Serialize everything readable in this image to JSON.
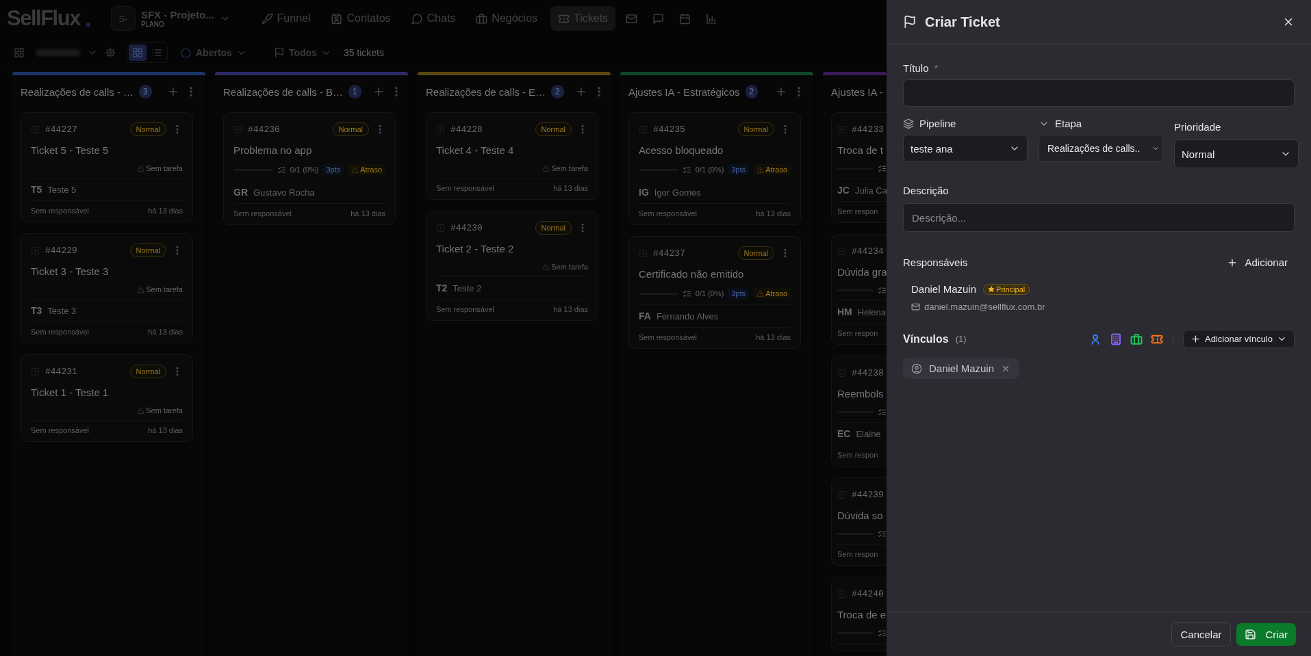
{
  "app": {
    "logo": "SellFlux",
    "workspace": {
      "avatar": "S-",
      "name": "SFX - Projeto...",
      "plan": "PLANO"
    }
  },
  "nav": [
    {
      "label": "Funnel",
      "selected": false
    },
    {
      "label": "Contatos",
      "selected": false
    },
    {
      "label": "Chats",
      "selected": false
    },
    {
      "label": "Negócios",
      "selected": false
    },
    {
      "label": "Tickets",
      "selected": true
    }
  ],
  "toolbar": {
    "views": [
      {
        "selected": true
      },
      {
        "selected": false
      }
    ],
    "status_filter": "Abertos",
    "type_filter": "Todos",
    "count": "35 tickets"
  },
  "columns": [
    {
      "title": "Realizações de calls - …",
      "count": "3",
      "color": "#1b3566",
      "cards": [
        {
          "kind": "no_task",
          "id": "#44227",
          "priority": "Normal",
          "title": "Ticket 5 - Teste 5",
          "task": "Sem tarefa",
          "initials": "T5",
          "contact": "Teste 5",
          "assignee": "Sem responsável",
          "age": "há 13 dias"
        },
        {
          "kind": "no_task",
          "id": "#44229",
          "priority": "Normal",
          "title": "Ticket 3 - Teste 3",
          "task": "Sem tarefa",
          "initials": "T3",
          "contact": "Teste 3",
          "assignee": "Sem responsável",
          "age": "há 13 dias"
        },
        {
          "kind": "no_task",
          "id": "#44231",
          "priority": "Normal",
          "title": "Ticket 1 - Teste 1",
          "task": "Sem tarefa",
          "assignee": "Sem responsável",
          "age": "há 13 dias"
        }
      ]
    },
    {
      "title": "Realizações de calls - B…",
      "count": "1",
      "color": "#2c2a66",
      "cards": [
        {
          "kind": "progress",
          "id": "#44236",
          "priority": "Normal",
          "title": "Problema no app",
          "level": 0,
          "progress": "0/1 (0%)",
          "points": "3pts",
          "late": "Atraso",
          "initials": "GR",
          "contact": "Gustavo Rocha",
          "assignee": "Sem responsável",
          "age": "há 13 dias"
        }
      ]
    },
    {
      "title": "Realizações de calls - E…",
      "count": "2",
      "color": "#5a4810",
      "cards": [
        {
          "kind": "no_task",
          "id": "#44228",
          "priority": "Normal",
          "title": "Ticket 4 - Teste 4",
          "task": "Sem tarefa",
          "assignee": "Sem responsável",
          "age": "há 13 dias"
        },
        {
          "kind": "no_task",
          "id": "#44230",
          "priority": "Normal",
          "title": "Ticket 2 - Teste 2",
          "task": "Sem tarefa",
          "initials": "T2",
          "contact": "Teste 2",
          "assignee": "Sem responsável",
          "age": "há 13 dias"
        }
      ]
    },
    {
      "title": "Ajustes IA - Estratégicos",
      "count": "2",
      "color": "#0f4a28",
      "cards": [
        {
          "kind": "progress",
          "id": "#44235",
          "priority": "Normal",
          "title": "Acesso bloqueado",
          "level": 0,
          "progress": "0/1 (0%)",
          "points": "3pts",
          "late": "Atraso",
          "initials": "IG",
          "contact": "Igor Gomes",
          "assignee": "Sem responsável",
          "age": "há 13 dias"
        },
        {
          "kind": "progress",
          "id": "#44237",
          "priority": "Normal",
          "title": "Certificado não emitido",
          "level": 0,
          "progress": "0/1 (0%)",
          "points": "3pts",
          "late": "Atraso",
          "initials": "FA",
          "contact": "Fernando Alves",
          "assignee": "Sem responsável",
          "age": "há 13 dias"
        }
      ]
    },
    {
      "title": "Ajustes IA -",
      "color": "#3a1a5a",
      "cards": [
        {
          "kind": "progress",
          "id": "#44233",
          "title": "Troca de t",
          "level": 0,
          "initials": "JC",
          "contact": "Julia Ca",
          "assignee": "Sem respon"
        },
        {
          "kind": "progress",
          "id": "#44234",
          "title": "Dúvida gra",
          "level": 0,
          "initials": "HM",
          "contact": "Helena",
          "assignee": "Sem respon"
        },
        {
          "kind": "progress",
          "id": "#44238",
          "title": "Reembols",
          "level": 0,
          "initials": "EC",
          "contact": "Elaine",
          "assignee": "Sem respon"
        },
        {
          "kind": "progress",
          "id": "#44239",
          "title": "Dúvida so",
          "level": 0,
          "assignee": "Sem respon"
        },
        {
          "kind": "progress",
          "id": "#44240",
          "title": "Troca de e",
          "level": 0
        }
      ]
    }
  ],
  "panel": {
    "title": "Criar Ticket",
    "title_field": {
      "label": "Título",
      "required_mark": "*"
    },
    "pipeline": {
      "label": "Pipeline",
      "value": "teste ana"
    },
    "stage": {
      "label": "Etapa",
      "value": "Realizações de calls.."
    },
    "priority": {
      "label": "Prioridade",
      "value": "Normal"
    },
    "description": {
      "label": "Descrição",
      "placeholder": "Descrição..."
    },
    "responsibles": {
      "label": "Responsáveis",
      "add": "Adicionar",
      "people": [
        {
          "name": "Daniel Mazuin",
          "badge": "Principal",
          "email": "daniel.mazuin@sellflux.com.br"
        }
      ]
    },
    "links": {
      "label": "Vínculos",
      "count": "(1)",
      "add": "Adicionar vínculo",
      "types": [
        {
          "color": "#3b82f6"
        },
        {
          "color": "#8b5cf6"
        },
        {
          "color": "#22c55e"
        },
        {
          "color": "#f97316"
        }
      ],
      "chips": [
        {
          "label": "Daniel Mazuin"
        }
      ]
    },
    "cancel": "Cancelar",
    "submit": "Criar"
  }
}
